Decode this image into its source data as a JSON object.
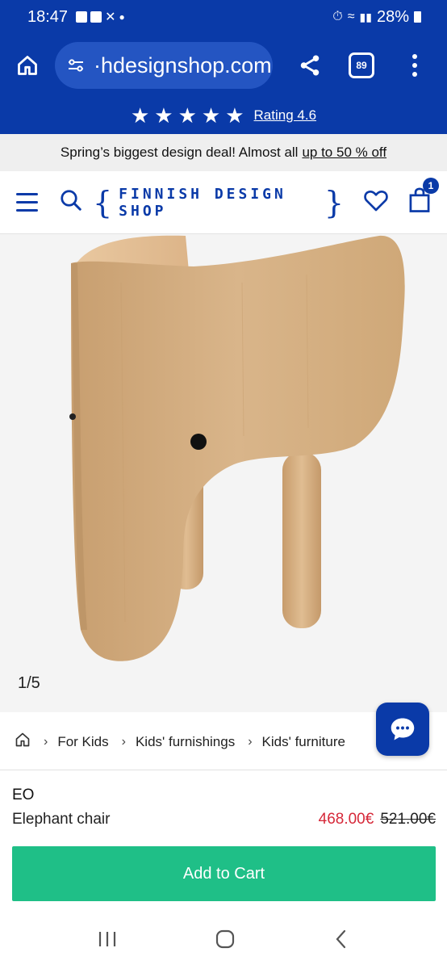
{
  "status_bar": {
    "time": "18:47",
    "battery": "28%"
  },
  "browser": {
    "url": "·hdesignshop.com",
    "tab_count": "89"
  },
  "rating": {
    "label": "Rating 4.6",
    "stars": 5
  },
  "promo": {
    "text": "Spring’s biggest design deal! Almost all",
    "link": "up to 50 % off"
  },
  "header": {
    "logo_text": "FINNISH DESIGN SHOP",
    "cart_count": "1"
  },
  "gallery": {
    "counter": "1/5"
  },
  "breadcrumb": {
    "items": [
      "For Kids",
      "Kids' furnishings",
      "Kids' furniture"
    ]
  },
  "product": {
    "brand": "EO",
    "name": "Elephant chair",
    "sale_price": "468.00€",
    "original_price": "521.00€",
    "add_to_cart": "Add to Cart"
  },
  "colors": {
    "brand_blue": "#0a3aa8",
    "cta_green": "#1fbf87",
    "sale_red": "#d62839"
  }
}
